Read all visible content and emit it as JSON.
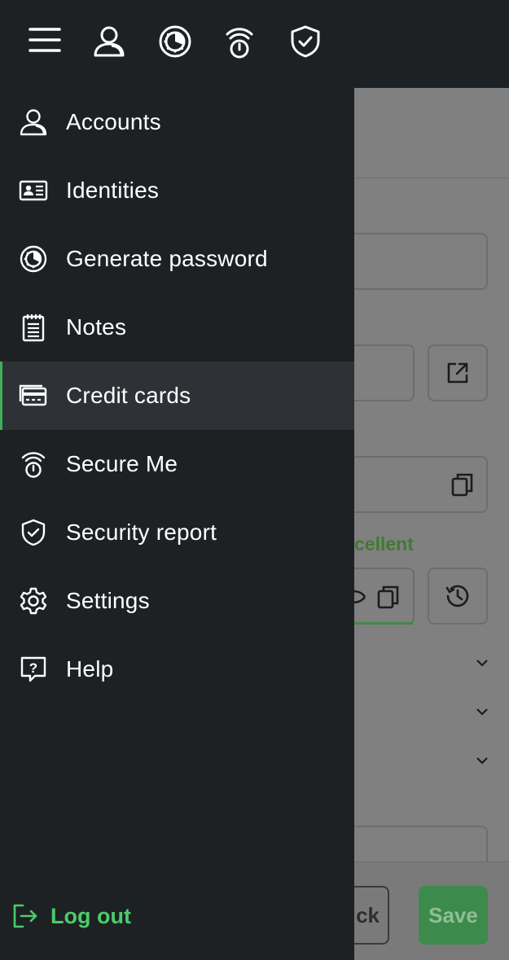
{
  "topbar": {
    "icons": [
      "menu-icon",
      "accounts-icon",
      "generate-password-icon",
      "secure-me-icon",
      "security-report-icon"
    ]
  },
  "drawer": {
    "items": [
      {
        "label": "Accounts",
        "icon": "accounts-icon",
        "active": false
      },
      {
        "label": "Identities",
        "icon": "id-card-icon",
        "active": false
      },
      {
        "label": "Generate password",
        "icon": "generate-password-icon",
        "active": false
      },
      {
        "label": "Notes",
        "icon": "notes-icon",
        "active": false
      },
      {
        "label": "Credit cards",
        "icon": "credit-card-icon",
        "active": true
      },
      {
        "label": "Secure Me",
        "icon": "secure-me-icon",
        "active": false
      },
      {
        "label": "Security report",
        "icon": "shield-check-icon",
        "active": false
      },
      {
        "label": "Settings",
        "icon": "gear-icon",
        "active": false
      },
      {
        "label": "Help",
        "icon": "help-icon",
        "active": false
      }
    ],
    "logout_label": "Log out"
  },
  "background": {
    "strength_text": "cellent",
    "back_button_label": "ck",
    "save_button_label": "Save"
  },
  "colors": {
    "drawer_bg": "#1e2124",
    "active_bg": "#2e3136",
    "accent_green": "#4ccb6a",
    "overlay": "#808080"
  }
}
